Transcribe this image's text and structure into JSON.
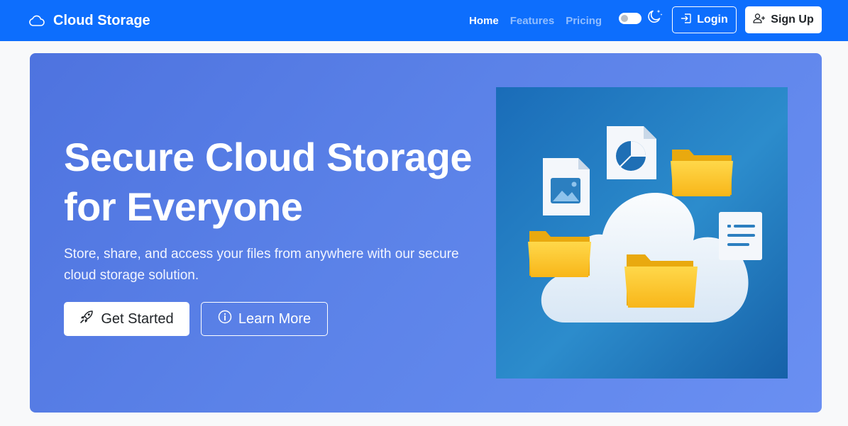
{
  "brand": {
    "name": "Cloud Storage",
    "icon": "cloud-icon"
  },
  "nav": {
    "links": [
      {
        "label": "Home",
        "active": true
      },
      {
        "label": "Features",
        "active": false
      },
      {
        "label": "Pricing",
        "active": false
      }
    ],
    "theme_toggle": {
      "icon": "moon-stars-icon",
      "checked": false
    },
    "login_label": "Login",
    "signup_label": "Sign Up"
  },
  "hero": {
    "title_line1": "Secure Cloud Storage",
    "title_line2": "for Everyone",
    "subtitle_line1": "Store, share, and access your files from anywhere with our secure",
    "subtitle_line2": "cloud storage solution.",
    "primary_button": {
      "label": "Get Started",
      "icon": "rocket-icon"
    },
    "secondary_button": {
      "label": "Learn More",
      "icon": "info-circle-icon"
    },
    "illustration": "cloud-storage-illustration"
  },
  "colors": {
    "navbar": "#0d6efd",
    "hero_gradient_start": "#4e73df",
    "hero_gradient_end": "#6a8ff2",
    "page_background": "#f8f9fa",
    "folder": "#ffc928",
    "illustration_bg": "#1e7fc8"
  }
}
